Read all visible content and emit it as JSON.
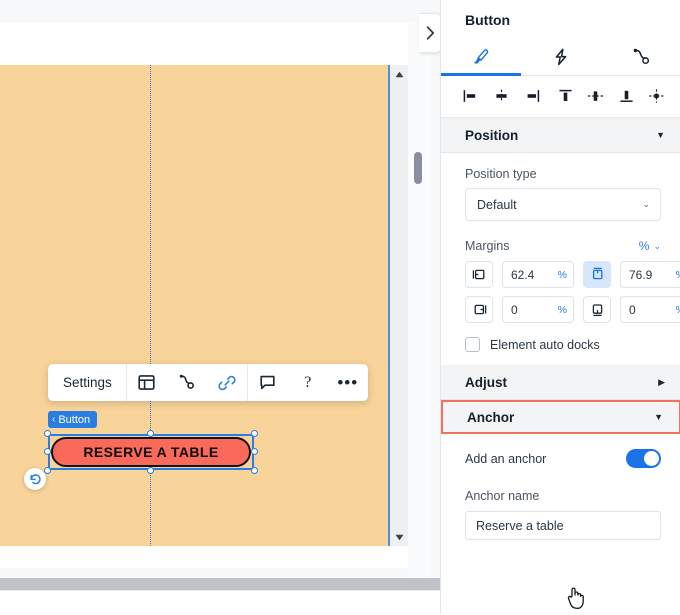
{
  "panel": {
    "title": "Button",
    "tabs": [
      {
        "name": "design-tab",
        "icon": "paintbrush-icon",
        "active": true
      },
      {
        "name": "interactions-tab",
        "icon": "lightning-bolt-icon",
        "active": false
      },
      {
        "name": "connections-tab",
        "icon": "node-connector-icon",
        "active": false
      }
    ],
    "align_buttons": [
      {
        "name": "align-left-icon"
      },
      {
        "name": "align-center-horizontal-icon"
      },
      {
        "name": "align-right-icon"
      },
      {
        "name": "align-top-icon"
      },
      {
        "name": "align-middle-vertical-icon"
      },
      {
        "name": "align-bottom-icon"
      },
      {
        "name": "align-center-both-icon"
      }
    ],
    "sections": {
      "position": {
        "label": "Position",
        "expanded": true,
        "caret": "▼",
        "position_type_label": "Position type",
        "position_type_value": "Default",
        "margins_label": "Margins",
        "margins_unit": "%",
        "margins_unit_caret": "⌄",
        "margin_fields": [
          {
            "icon": "margin-left-icon",
            "value": "62.4",
            "unit": "%",
            "selected": false
          },
          {
            "icon": "margin-top-icon",
            "value": "76.9",
            "unit": "%",
            "selected": true
          },
          {
            "icon": "margin-right-icon",
            "value": "0",
            "unit": "%",
            "selected": false
          },
          {
            "icon": "margin-bottom-icon",
            "value": "0",
            "unit": "%",
            "selected": false
          }
        ],
        "auto_dock_label": "Element auto docks",
        "auto_dock_checked": false
      },
      "adjust": {
        "label": "Adjust",
        "expanded": false,
        "caret": "▶"
      },
      "anchor": {
        "label": "Anchor",
        "expanded": true,
        "caret": "▼",
        "highlight_color": "#f2715c",
        "add_anchor_label": "Add an anchor",
        "add_anchor_on": true,
        "anchor_name_label": "Anchor name",
        "anchor_name_value": "Reserve a table",
        "anchor_name_placeholder": "Anchor name"
      }
    }
  },
  "canvas": {
    "background_color": "#f8d49a",
    "element_badge": {
      "chevron": "‹",
      "label": "Button"
    },
    "cta_button": {
      "label": "RESERVE A TABLE",
      "fill": "#fa6a5a",
      "border_color": "#111111",
      "text_color": "#0d0d0d"
    },
    "undo_icon": "undo-icon",
    "scroll_up_icon": "scroll-up-arrow-icon",
    "scroll_down_icon": "scroll-down-arrow-icon",
    "collapse_icon": "chevron-right-icon"
  },
  "element_toolbar": {
    "settings_label": "Settings",
    "items": [
      {
        "name": "layout-icon"
      },
      {
        "name": "node-connector-icon"
      },
      {
        "name": "link-icon",
        "accent": "#2a7de1"
      },
      {
        "name": "comment-icon"
      },
      {
        "name": "help-icon",
        "glyph": "?"
      },
      {
        "name": "more-options-icon",
        "glyph": "•••"
      }
    ]
  },
  "colors": {
    "accent_blue": "#1a73e8",
    "selection_blue": "#2a7de1",
    "highlight_orange": "#f2715c",
    "canvas_orange": "#f8d49a"
  }
}
